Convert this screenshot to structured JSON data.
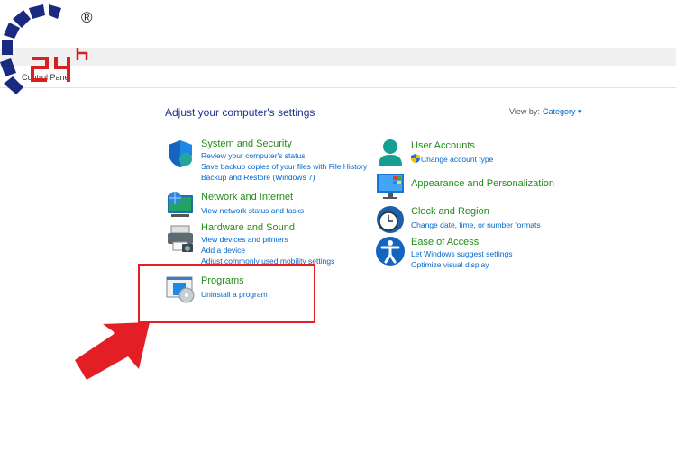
{
  "watermark": {
    "text": "24h",
    "mark": "®"
  },
  "breadcrumb": "Control Panel",
  "page": {
    "heading": "Adjust your computer's settings",
    "view_by_label": "View by:",
    "view_by_value": "Category"
  },
  "left_categories": [
    {
      "title": "System and Security",
      "links": [
        "Review your computer's status",
        "Save backup copies of your files with File History",
        "Backup and Restore (Windows 7)"
      ]
    },
    {
      "title": "Network and Internet",
      "links": [
        "View network status and tasks"
      ]
    },
    {
      "title": "Hardware and Sound",
      "links": [
        "View devices and printers",
        "Add a device",
        "Adjust commonly used mobility settings"
      ]
    },
    {
      "title": "Programs",
      "links": [
        "Uninstall a program"
      ]
    }
  ],
  "right_categories": [
    {
      "title": "User Accounts",
      "links": [
        "Change account type"
      ]
    },
    {
      "title": "Appearance and Personalization",
      "links": []
    },
    {
      "title": "Clock and Region",
      "links": [
        "Change date, time, or number formats"
      ]
    },
    {
      "title": "Ease of Access",
      "links": [
        "Let Windows suggest settings",
        "Optimize visual display"
      ]
    }
  ],
  "colors": {
    "accent": "#0066cc",
    "category_title": "#248c19",
    "highlight": "#e31e24"
  }
}
